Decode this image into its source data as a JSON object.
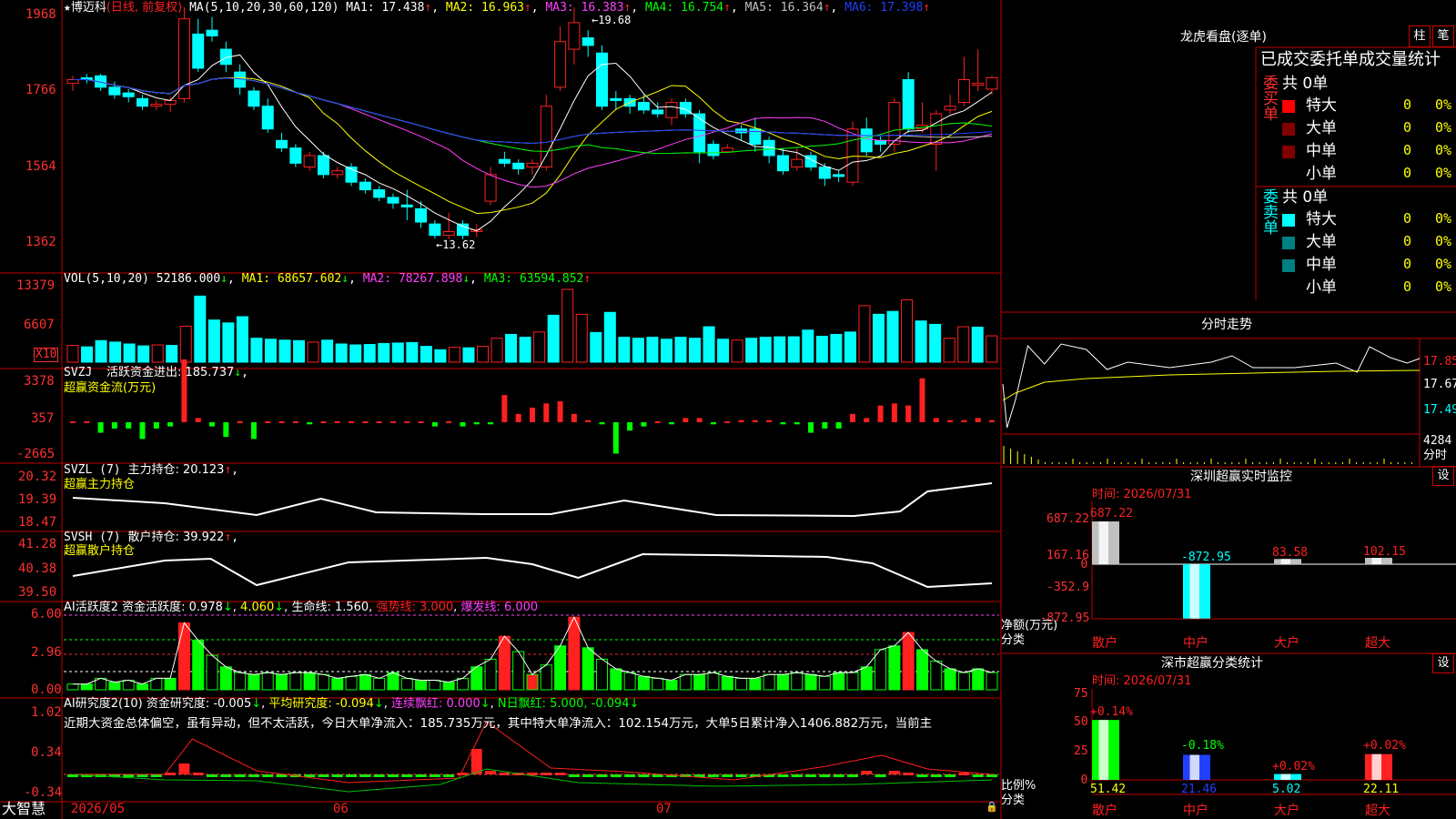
{
  "colors": {
    "up": "#ff2020",
    "down": "#00ffff",
    "frame": "#c00000",
    "ma1": "#ffffff",
    "ma2": "#ffff00",
    "ma3": "#ff40ff",
    "ma4": "#00ff00",
    "ma5": "#c0c0c0",
    "ma6": "#2040ff"
  },
  "main": {
    "stock_name": "博迈科",
    "star": "★",
    "mode": "(日线, 前复权)",
    "ma_label": "MA(5,10,20,30,60,120)",
    "ma1": "MA1: 17.438",
    "ma2": "MA2: 16.963",
    "ma3": "MA3: 16.383",
    "ma4": "MA4: 16.754",
    "ma5": "MA5: 16.364",
    "ma6": "MA6: 17.398",
    "high_mark": "19.68",
    "low_mark": "13.62",
    "y_ticks": [
      "1968",
      "1766",
      "1564",
      "1362"
    ],
    "candles": [
      {
        "o": 17.7,
        "h": 17.9,
        "l": 17.5,
        "c": 17.8
      },
      {
        "o": 17.85,
        "h": 17.95,
        "l": 17.7,
        "c": 17.8
      },
      {
        "o": 17.9,
        "h": 17.95,
        "l": 17.5,
        "c": 17.6
      },
      {
        "o": 17.6,
        "h": 17.75,
        "l": 17.3,
        "c": 17.4
      },
      {
        "o": 17.45,
        "h": 17.55,
        "l": 17.2,
        "c": 17.35
      },
      {
        "o": 17.3,
        "h": 17.4,
        "l": 17.0,
        "c": 17.1
      },
      {
        "o": 17.1,
        "h": 17.25,
        "l": 17.0,
        "c": 17.15
      },
      {
        "o": 17.15,
        "h": 17.35,
        "l": 16.95,
        "c": 17.25
      },
      {
        "o": 17.3,
        "h": 19.7,
        "l": 17.2,
        "c": 19.4
      },
      {
        "o": 19.0,
        "h": 19.4,
        "l": 18.0,
        "c": 18.1
      },
      {
        "o": 19.1,
        "h": 19.45,
        "l": 18.8,
        "c": 18.95
      },
      {
        "o": 18.6,
        "h": 18.8,
        "l": 18.0,
        "c": 18.2
      },
      {
        "o": 18.0,
        "h": 18.2,
        "l": 17.4,
        "c": 17.6
      },
      {
        "o": 17.5,
        "h": 17.6,
        "l": 17.0,
        "c": 17.1
      },
      {
        "o": 17.1,
        "h": 17.3,
        "l": 16.4,
        "c": 16.5
      },
      {
        "o": 16.2,
        "h": 16.4,
        "l": 15.9,
        "c": 16.0
      },
      {
        "o": 16.0,
        "h": 16.1,
        "l": 15.5,
        "c": 15.6
      },
      {
        "o": 15.5,
        "h": 15.9,
        "l": 15.4,
        "c": 15.8
      },
      {
        "o": 15.8,
        "h": 15.9,
        "l": 15.2,
        "c": 15.3
      },
      {
        "o": 15.3,
        "h": 15.5,
        "l": 15.2,
        "c": 15.4
      },
      {
        "o": 15.5,
        "h": 15.6,
        "l": 15.0,
        "c": 15.1
      },
      {
        "o": 15.1,
        "h": 15.2,
        "l": 14.8,
        "c": 14.9
      },
      {
        "o": 14.9,
        "h": 15.0,
        "l": 14.6,
        "c": 14.7
      },
      {
        "o": 14.7,
        "h": 14.8,
        "l": 14.4,
        "c": 14.55
      },
      {
        "o": 14.5,
        "h": 14.9,
        "l": 14.1,
        "c": 14.45
      },
      {
        "o": 14.4,
        "h": 14.6,
        "l": 13.9,
        "c": 14.05
      },
      {
        "o": 14.0,
        "h": 14.1,
        "l": 13.62,
        "c": 13.7
      },
      {
        "o": 13.7,
        "h": 14.3,
        "l": 13.6,
        "c": 13.8
      },
      {
        "o": 14.0,
        "h": 14.1,
        "l": 13.6,
        "c": 13.7
      },
      {
        "o": 13.8,
        "h": 14.0,
        "l": 13.65,
        "c": 13.85
      },
      {
        "o": 14.6,
        "h": 15.5,
        "l": 14.5,
        "c": 15.3
      },
      {
        "o": 15.7,
        "h": 15.9,
        "l": 15.5,
        "c": 15.6
      },
      {
        "o": 15.6,
        "h": 15.7,
        "l": 15.3,
        "c": 15.45
      },
      {
        "o": 15.5,
        "h": 15.7,
        "l": 15.3,
        "c": 15.6
      },
      {
        "o": 15.5,
        "h": 17.4,
        "l": 15.4,
        "c": 17.1
      },
      {
        "o": 17.6,
        "h": 19.2,
        "l": 17.5,
        "c": 18.8
      },
      {
        "o": 18.6,
        "h": 19.7,
        "l": 18.2,
        "c": 19.3
      },
      {
        "o": 18.9,
        "h": 19.1,
        "l": 18.4,
        "c": 18.7
      },
      {
        "o": 18.5,
        "h": 18.7,
        "l": 17.0,
        "c": 17.1
      },
      {
        "o": 17.3,
        "h": 17.5,
        "l": 17.0,
        "c": 17.25
      },
      {
        "o": 17.3,
        "h": 17.4,
        "l": 16.9,
        "c": 17.1
      },
      {
        "o": 17.2,
        "h": 17.4,
        "l": 16.9,
        "c": 17.0
      },
      {
        "o": 17.0,
        "h": 17.2,
        "l": 16.8,
        "c": 16.9
      },
      {
        "o": 16.8,
        "h": 17.3,
        "l": 16.6,
        "c": 17.2
      },
      {
        "o": 17.2,
        "h": 17.3,
        "l": 16.8,
        "c": 16.9
      },
      {
        "o": 16.9,
        "h": 17.0,
        "l": 15.6,
        "c": 15.9
      },
      {
        "o": 16.1,
        "h": 16.2,
        "l": 15.7,
        "c": 15.8
      },
      {
        "o": 15.9,
        "h": 16.1,
        "l": 15.9,
        "c": 16.0
      },
      {
        "o": 16.5,
        "h": 16.6,
        "l": 16.2,
        "c": 16.4
      },
      {
        "o": 16.5,
        "h": 16.8,
        "l": 15.9,
        "c": 16.1
      },
      {
        "o": 16.2,
        "h": 16.3,
        "l": 15.6,
        "c": 15.8
      },
      {
        "o": 15.8,
        "h": 16.0,
        "l": 15.3,
        "c": 15.4
      },
      {
        "o": 15.5,
        "h": 16.0,
        "l": 15.4,
        "c": 15.7
      },
      {
        "o": 15.8,
        "h": 15.9,
        "l": 15.4,
        "c": 15.5
      },
      {
        "o": 15.5,
        "h": 15.6,
        "l": 15.0,
        "c": 15.2
      },
      {
        "o": 15.3,
        "h": 15.4,
        "l": 15.1,
        "c": 15.25
      },
      {
        "o": 15.1,
        "h": 16.7,
        "l": 15.0,
        "c": 16.5
      },
      {
        "o": 16.5,
        "h": 16.8,
        "l": 15.8,
        "c": 15.9
      },
      {
        "o": 16.2,
        "h": 16.3,
        "l": 15.9,
        "c": 16.1
      },
      {
        "o": 16.1,
        "h": 17.3,
        "l": 15.9,
        "c": 17.2
      },
      {
        "o": 17.8,
        "h": 18.0,
        "l": 16.4,
        "c": 16.5
      },
      {
        "o": 16.5,
        "h": 17.2,
        "l": 16.4,
        "c": 16.6
      },
      {
        "o": 16.1,
        "h": 17.0,
        "l": 15.4,
        "c": 16.9
      },
      {
        "o": 17.0,
        "h": 17.4,
        "l": 16.9,
        "c": 17.1
      },
      {
        "o": 17.2,
        "h": 18.4,
        "l": 17.1,
        "c": 17.8
      },
      {
        "o": 17.65,
        "h": 18.6,
        "l": 17.5,
        "c": 17.7
      },
      {
        "o": 17.55,
        "h": 17.9,
        "l": 17.4,
        "c": 17.85
      }
    ],
    "x_labels": [
      "2026/05",
      "06",
      "07"
    ]
  },
  "vol": {
    "label": "VOL(5,10,20)",
    "value": "52186.000",
    "ma1": "MA1: 68657.602",
    "ma2": "MA2: 78267.898",
    "ma3": "MA3: 63594.852",
    "y_ticks": [
      "13379",
      "6607"
    ],
    "unit": "X10",
    "bars": [
      3.5,
      3.2,
      4.5,
      4.2,
      3.8,
      3.4,
      3.6,
      3.5,
      7.5,
      13.8,
      8.8,
      8.2,
      9.5,
      5.0,
      4.8,
      4.6,
      4.5,
      4.2,
      4.6,
      3.8,
      3.6,
      3.7,
      3.9,
      4.0,
      4.1,
      3.3,
      2.6,
      3.1,
      3.0,
      3.3,
      5.0,
      5.8,
      5.2,
      6.3,
      9.8,
      15.2,
      10.0,
      6.2,
      10.4,
      5.2,
      5.0,
      5.2,
      4.8,
      5.2,
      5.0,
      7.4,
      4.8,
      4.6,
      5.0,
      5.2,
      5.3,
      5.3,
      6.7,
      5.4,
      5.8,
      6.3,
      11.8,
      10.0,
      10.6,
      13.0,
      8.6,
      7.9,
      5.0,
      7.4,
      7.3,
      5.5
    ]
  },
  "svzj": {
    "label": "SVZJ",
    "title": "活跃资金进出: 185.737",
    "sub": "超赢资金流(万元)",
    "y_ticks": [
      "3378",
      "357",
      "-2665"
    ],
    "bars": [
      0,
      0,
      -0.5,
      -0.3,
      -0.3,
      -0.8,
      -0.3,
      -0.2,
      3.0,
      0.2,
      -0.2,
      -0.7,
      0,
      -0.8,
      0,
      0,
      0,
      -0.1,
      0,
      0,
      0,
      0,
      0,
      0,
      0,
      0,
      -0.2,
      0,
      -0.2,
      -0.1,
      -0.1,
      1.3,
      0.4,
      0.7,
      0.9,
      1.0,
      0.4,
      0.1,
      -0.1,
      -1.5,
      -0.4,
      -0.2,
      0,
      -0.1,
      0.2,
      0.2,
      -0.1,
      0,
      0.1,
      0.1,
      0.1,
      -0.1,
      -0.1,
      -0.5,
      -0.3,
      -0.3,
      0.4,
      0.2,
      0.8,
      0.9,
      0.8,
      2.1,
      0.2,
      0.1,
      0.1,
      0.2,
      0.1
    ]
  },
  "svzl": {
    "label": "SVZL (7)",
    "title": "主力持仓: 20.123",
    "sub": "超赢主力持仓",
    "y_ticks": [
      "20.32",
      "19.39",
      "18.47"
    ]
  },
  "svsh": {
    "label": "SVSH (7)",
    "title": "散户持仓: 39.922",
    "sub": "超赢散户持仓",
    "y_ticks": [
      "41.28",
      "40.38",
      "39.50"
    ]
  },
  "ai1": {
    "label": "AI活跃度2",
    "title": "资金活跃度: 0.978",
    "v2": "4.060",
    "life": "生命线: 1.560",
    "strong": "强势线: 3.000",
    "burst": "爆发线: 6.000",
    "y_ticks": [
      "6.00",
      "2.96",
      "0.00"
    ]
  },
  "ai2": {
    "label": "AI研究度2(10)",
    "title": "资金研究度: -0.005",
    "avg": "平均研究度: -0.094",
    "lx": "连续飘红: 0.000",
    "nd": "N日飘红: 5.000, -0.094",
    "comment": "近期大资金总体偏空，虽有异动，但不太活跃，今日大单净流入：185.735万元，其中特大单净流入：102.154万元，大单5日累计净入1406.882万元，当前主",
    "y_ticks": [
      "1.02",
      "0.34",
      "-0.34"
    ]
  },
  "bottom": {
    "brand": "大智慧"
  },
  "right": {
    "lhb_title": "龙虎看盘(逐单)",
    "btn_bar": "柱",
    "btn_pen": "笔",
    "tabs_title": "已成交委托单成交量统计",
    "buy_label": "委买单",
    "sell_label": "委卖单",
    "buy_total": "共 0单",
    "sell_total": "共 0单",
    "rows": [
      {
        "name": "特大",
        "v": "0",
        "p": "0%"
      },
      {
        "name": "大单",
        "v": "0",
        "p": "0%"
      },
      {
        "name": "中单",
        "v": "0",
        "p": "0%"
      },
      {
        "name": "小单",
        "v": "0",
        "p": "0%"
      }
    ],
    "buy_colors": [
      "#ff0000",
      "#800000",
      "#800000",
      "#000000"
    ],
    "sell_colors": [
      "#00ffff",
      "#008080",
      "#008080",
      "#000000"
    ],
    "fs_title": "分时走势",
    "fs_y": [
      "17.85",
      "17.67",
      "17.49"
    ],
    "fs_vol": "4284",
    "fs_unit": "分时",
    "sz_title": "深圳超赢实时监控",
    "sz_btn": "设",
    "sz_time": "时间: 2026/07/31",
    "sz_y": [
      "687.22",
      "167.16",
      "0",
      "-352.9",
      "-872.95"
    ],
    "sz_vals": [
      687.22,
      -872.95,
      83.58,
      102.15
    ],
    "sz_labels_v": [
      "687.22",
      "-872.95",
      "83.58",
      "102.15"
    ],
    "sz_cats": [
      "散户",
      "中户",
      "大户",
      "超大"
    ],
    "sz_axis1": "净额(万元)",
    "sz_axis2": "分类",
    "sc_title": "深市超赢分类统计",
    "sc_btn": "设",
    "sc_time": "时间: 2026/07/31",
    "sc_y": [
      "75",
      "50",
      "25",
      "0"
    ],
    "sc_vals": [
      51.42,
      21.46,
      5.02,
      22.11
    ],
    "sc_pcts": [
      "+0.14%",
      "-0.18%",
      "+0.02%",
      "+0.02%"
    ],
    "sc_labels_v": [
      "51.42",
      "21.46",
      "5.02",
      "22.11"
    ],
    "sc_axis1": "比例%",
    "sc_axis2": "分类"
  }
}
